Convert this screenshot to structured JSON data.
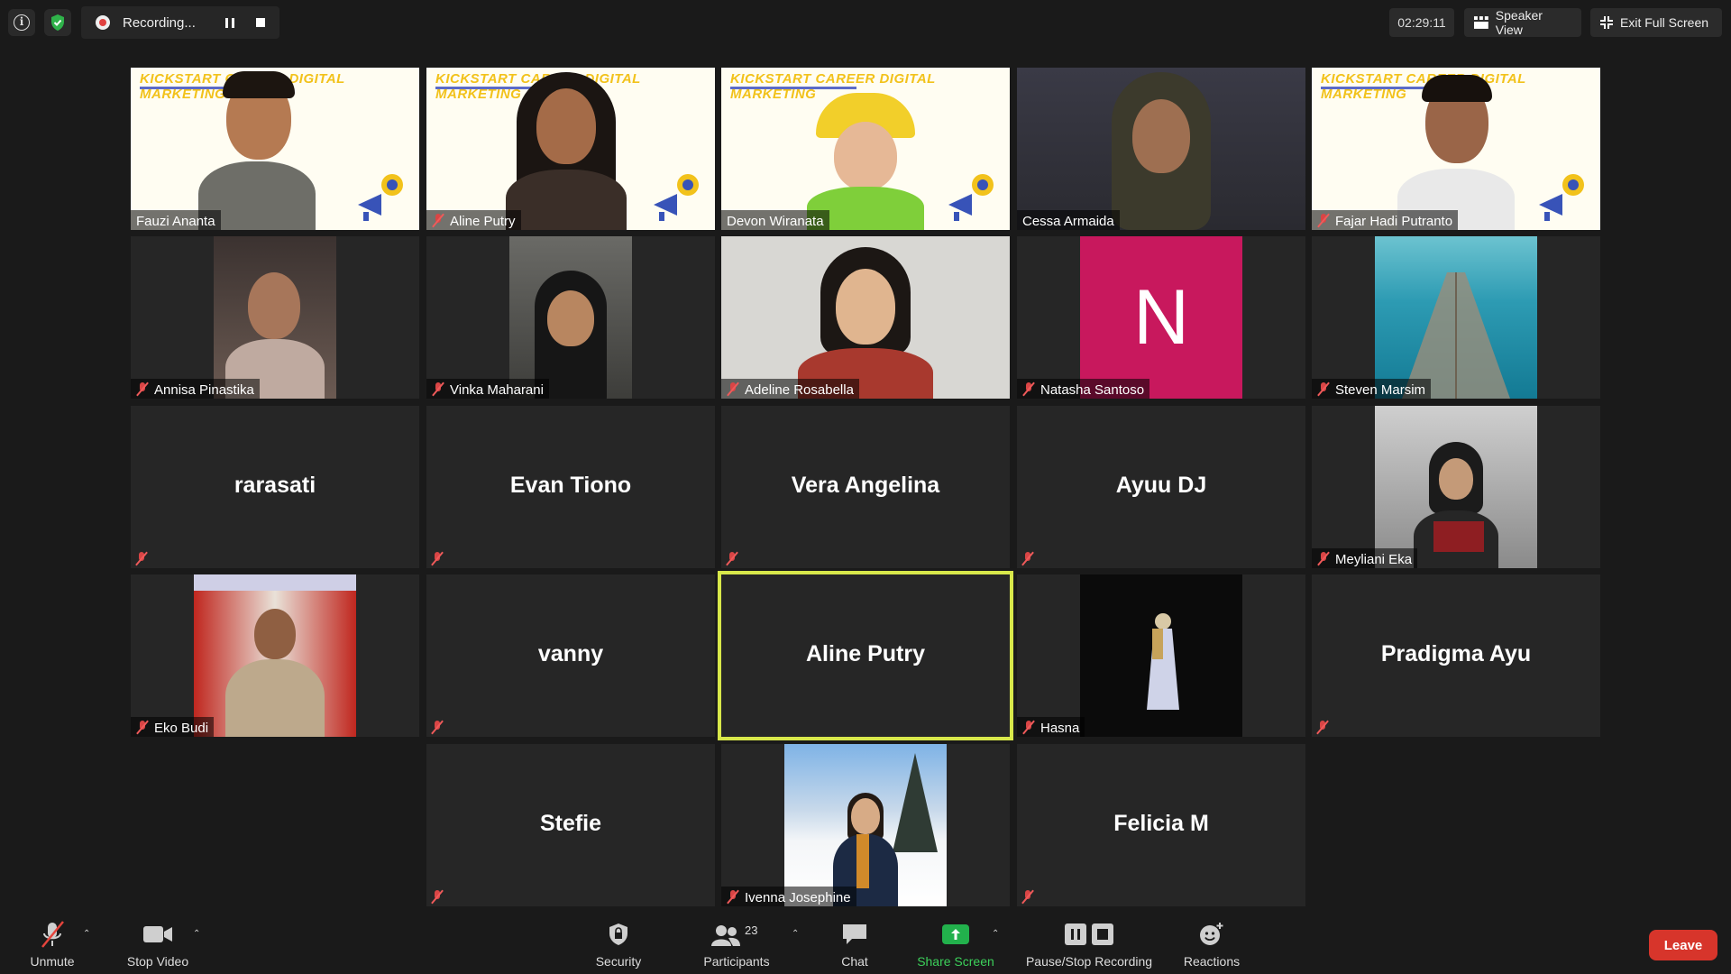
{
  "topbar": {
    "recording_text": "Recording...",
    "timer": "02:29:11",
    "speaker_view": "Speaker View",
    "exit_full_screen": "Exit Full Screen"
  },
  "participants": [
    {
      "name": "Fauzi Ananta",
      "video": true,
      "banner": true,
      "muted": false
    },
    {
      "name": "Aline Putry",
      "video": true,
      "banner": true,
      "muted": true
    },
    {
      "name": "Devon Wiranata",
      "video": true,
      "banner": true,
      "muted": false
    },
    {
      "name": "Cessa Armaida",
      "video": true,
      "banner": false,
      "muted": false
    },
    {
      "name": "Fajar Hadi Putranto",
      "video": true,
      "banner": true,
      "muted": true
    },
    {
      "name": "Annisa Pinastika",
      "video": true,
      "muted": true
    },
    {
      "name": "Vinka Maharani",
      "video": true,
      "muted": true
    },
    {
      "name": "Adeline Rosabella",
      "video": true,
      "muted": true
    },
    {
      "name": "Natasha Santoso",
      "video": true,
      "avatar_letter": "N",
      "muted": true
    },
    {
      "name": "Steven Marsim",
      "video": true,
      "muted": true
    },
    {
      "name": "rarasati",
      "video": false,
      "muted": true
    },
    {
      "name": "Evan Tiono",
      "video": false,
      "muted": true
    },
    {
      "name": "Vera Angelina",
      "video": false,
      "muted": true
    },
    {
      "name": "Ayuu DJ",
      "video": false,
      "muted": true
    },
    {
      "name": "Meyliani Eka",
      "video": true,
      "muted": true
    },
    {
      "name": "Eko Budi",
      "video": true,
      "muted": true
    },
    {
      "name": "vanny",
      "video": false,
      "muted": true
    },
    {
      "name": "Aline Putry",
      "video": false,
      "muted": false,
      "active_speaker": true
    },
    {
      "name": "Hasna",
      "video": true,
      "muted": true
    },
    {
      "name": "Pradigma Ayu",
      "video": false,
      "muted": true
    },
    {
      "name": "Stefie",
      "video": false,
      "muted": true
    },
    {
      "name": "Ivenna Josephine",
      "video": true,
      "muted": true
    },
    {
      "name": "Felicia M",
      "video": false,
      "muted": true
    }
  ],
  "banner": {
    "title": "KICKSTART CAREER DIGITAL MARKETING"
  },
  "toolbar": {
    "unmute": "Unmute",
    "stop_video": "Stop Video",
    "security": "Security",
    "participants": "Participants",
    "participants_count": "23",
    "chat": "Chat",
    "share_screen": "Share Screen",
    "pause_stop_recording": "Pause/Stop Recording",
    "reactions": "Reactions",
    "leave": "Leave"
  },
  "colors": {
    "background": "#1a1a1a",
    "tile": "#262626",
    "active_border": "#d8e84a",
    "share_green": "#22b14c",
    "leave_red": "#d7352b",
    "muted_red": "#d94545",
    "avatar_magenta": "#c8185d"
  }
}
